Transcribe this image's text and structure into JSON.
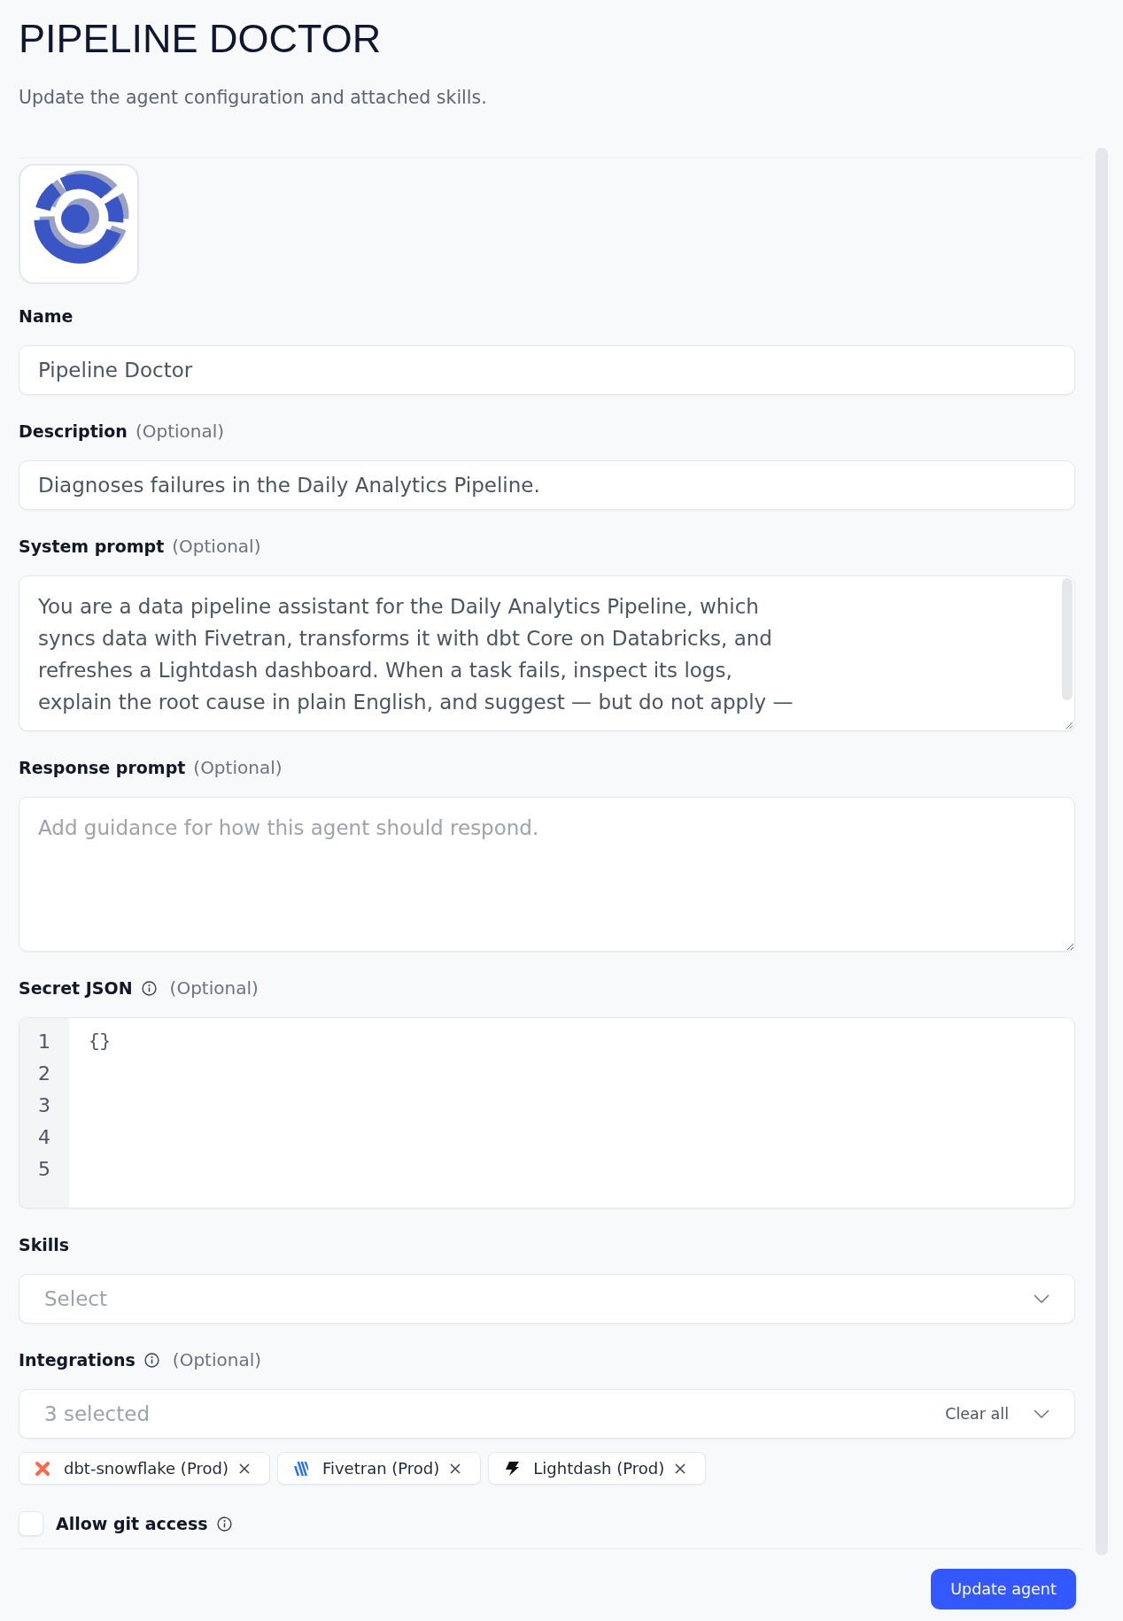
{
  "header": {
    "title": "PIPELINE DOCTOR",
    "subtitle": "Update the agent configuration and attached skills."
  },
  "fields": [
    {
      "kind": "input",
      "label": "Name",
      "value": "Pipeline Doctor"
    },
    {
      "kind": "input",
      "label": "Description",
      "hint": "(Optional)",
      "value": "Diagnoses failures in the Daily Analytics Pipeline."
    },
    {
      "kind": "textarea",
      "label": "System prompt",
      "hint": "(Optional)",
      "value": "You are a data pipeline assistant for the Daily Analytics Pipeline, which\nsyncs data with Fivetran, transforms it with dbt Core on Databricks, and\nrefreshes a Lightdash dashboard. When a task fails, inspect its logs,\nexplain the root cause in plain English, and suggest — but do not apply —"
    },
    {
      "kind": "textarea",
      "label": "Response prompt",
      "hint": "(Optional)",
      "placeholder": "Add guidance for how this agent should respond."
    },
    {
      "kind": "code",
      "label": "Secret JSON",
      "info": true,
      "hint": "(Optional)",
      "line_numbers": [
        "1",
        "2",
        "3",
        "4",
        "5"
      ],
      "lines": [
        "{}"
      ]
    },
    {
      "kind": "select",
      "label": "Skills",
      "placeholder": "Select"
    },
    {
      "kind": "multiselect",
      "label": "Integrations",
      "info": true,
      "hint": "(Optional)",
      "summary": "3 selected",
      "clear": "Clear all",
      "chips": [
        {
          "kind": "cross",
          "label": "dbt-snowflake (Prod)"
        },
        {
          "kind": "stripes",
          "label": "Fivetran (Prod)"
        },
        {
          "kind": "bolt",
          "label": "Lightdash (Prod)"
        }
      ]
    }
  ],
  "git_access": {
    "label": "Allow git access",
    "checked": false,
    "info": true
  },
  "submit_button": "Update agent"
}
